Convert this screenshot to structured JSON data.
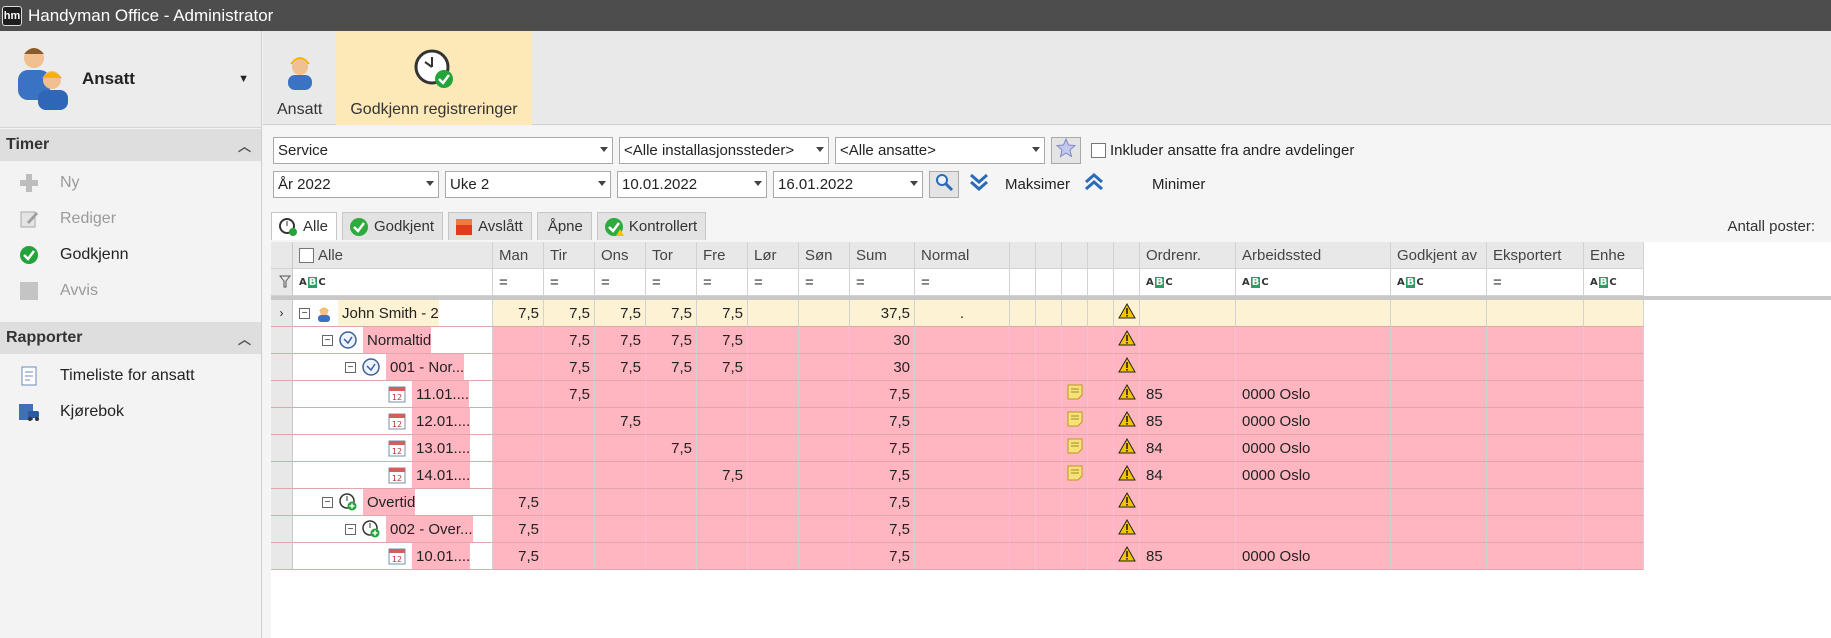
{
  "window": {
    "app_icon": "hm",
    "title": "Handyman Office - Administrator"
  },
  "sidebar": {
    "module_label": "Ansatt",
    "groups": [
      {
        "title": "Timer",
        "items": [
          {
            "label": "Ny",
            "icon": "plus-icon",
            "enabled": false
          },
          {
            "label": "Rediger",
            "icon": "edit-icon",
            "enabled": false
          },
          {
            "label": "Godkjenn",
            "icon": "check-icon",
            "enabled": true
          },
          {
            "label": "Avvis",
            "icon": "reject-icon",
            "enabled": false
          }
        ]
      },
      {
        "title": "Rapporter",
        "items": [
          {
            "label": "Timeliste for ansatt",
            "icon": "report-icon",
            "enabled": true
          },
          {
            "label": "Kjørebok",
            "icon": "car-icon",
            "enabled": true
          }
        ]
      }
    ]
  },
  "ribbon": {
    "buttons": [
      {
        "label": "Ansatt",
        "icon": "worker-icon",
        "active": false
      },
      {
        "label": "Godkjenn registreringer",
        "icon": "clock-check-icon",
        "active": true
      }
    ]
  },
  "filters": {
    "department": "Service",
    "location": "<Alle installasjonssteder>",
    "employees": "<Alle ansatte>",
    "include_other_departments_label": "Inkluder ansatte fra andre avdelinger",
    "include_other_departments": false,
    "year": "År 2022",
    "week": "Uke 2",
    "date_from": "10.01.2022",
    "date_to": "16.01.2022",
    "maximize_label": "Maksimer",
    "minimize_label": "Minimer"
  },
  "tabs": [
    {
      "label": "Alle",
      "active": true,
      "color": "#ffffff"
    },
    {
      "label": "Godkjent",
      "active": false,
      "color": "#2eaa3f"
    },
    {
      "label": "Avslått",
      "active": false,
      "color": "#e23b1c"
    },
    {
      "label": "Åpne",
      "active": false,
      "color": ""
    },
    {
      "label": "Kontrollert",
      "active": false,
      "color": "#2eaa3f"
    }
  ],
  "record_count_label": "Antall poster:",
  "grid": {
    "columns": [
      "Alle",
      "Man",
      "Tir",
      "Ons",
      "Tor",
      "Fre",
      "Lør",
      "Søn",
      "Sum",
      "Normal",
      "",
      "",
      "",
      "",
      "",
      "Ordrenr.",
      "Arbeidssted",
      "Godkjent av",
      "Eksportert",
      "Enhe"
    ],
    "filter_abc": "A B C",
    "filter_eq": "=",
    "rows": [
      {
        "level": 0,
        "label": "John Smith - 2",
        "icon": "person-icon",
        "color": "yellow",
        "days": [
          "7,5",
          "7,5",
          "7,5",
          "7,5",
          "7,5",
          "",
          ""
        ],
        "sum": "37,5",
        "normal": ".",
        "note": false,
        "warn": true,
        "ordre": "",
        "arbeidssted": ""
      },
      {
        "level": 1,
        "label": "Normaltid",
        "icon": "clock-icon",
        "color": "pink",
        "days": [
          "",
          "7,5",
          "7,5",
          "7,5",
          "7,5",
          "",
          ""
        ],
        "sum": "30",
        "normal": "",
        "note": false,
        "warn": true,
        "ordre": "",
        "arbeidssted": ""
      },
      {
        "level": 2,
        "label": "001 - Nor...",
        "icon": "clock-icon",
        "color": "pink",
        "days": [
          "",
          "7,5",
          "7,5",
          "7,5",
          "7,5",
          "",
          ""
        ],
        "sum": "30",
        "normal": "",
        "note": false,
        "warn": true,
        "ordre": "",
        "arbeidssted": ""
      },
      {
        "level": 3,
        "label": "11.01....",
        "icon": "calendar-icon",
        "color": "pink",
        "days": [
          "",
          "7,5",
          "",
          "",
          "",
          "",
          ""
        ],
        "sum": "7,5",
        "normal": "",
        "note": true,
        "warn": true,
        "ordre": "85",
        "arbeidssted": "0000 Oslo"
      },
      {
        "level": 3,
        "label": "12.01....",
        "icon": "calendar-icon",
        "color": "pink",
        "days": [
          "",
          "",
          "7,5",
          "",
          "",
          "",
          ""
        ],
        "sum": "7,5",
        "normal": "",
        "note": true,
        "warn": true,
        "ordre": "85",
        "arbeidssted": "0000 Oslo"
      },
      {
        "level": 3,
        "label": "13.01....",
        "icon": "calendar-icon",
        "color": "pink",
        "days": [
          "",
          "",
          "",
          "7,5",
          "",
          "",
          ""
        ],
        "sum": "7,5",
        "normal": "",
        "note": true,
        "warn": true,
        "ordre": "84",
        "arbeidssted": "0000 Oslo"
      },
      {
        "level": 3,
        "label": "14.01....",
        "icon": "calendar-icon",
        "color": "pink",
        "days": [
          "",
          "",
          "",
          "",
          "7,5",
          "",
          ""
        ],
        "sum": "7,5",
        "normal": "",
        "note": true,
        "warn": true,
        "ordre": "84",
        "arbeidssted": "0000 Oslo"
      },
      {
        "level": 1,
        "label": "Overtid",
        "icon": "overtime-icon",
        "color": "pink",
        "days": [
          "7,5",
          "",
          "",
          "",
          "",
          "",
          ""
        ],
        "sum": "7,5",
        "normal": "",
        "note": false,
        "warn": true,
        "ordre": "",
        "arbeidssted": ""
      },
      {
        "level": 2,
        "label": "002 - Over...",
        "icon": "overtime-icon",
        "color": "pink",
        "days": [
          "7,5",
          "",
          "",
          "",
          "",
          "",
          ""
        ],
        "sum": "7,5",
        "normal": "",
        "note": false,
        "warn": true,
        "ordre": "",
        "arbeidssted": ""
      },
      {
        "level": 3,
        "label": "10.01....",
        "icon": "calendar-icon",
        "color": "pink",
        "days": [
          "7,5",
          "",
          "",
          "",
          "",
          "",
          ""
        ],
        "sum": "7,5",
        "normal": "",
        "note": false,
        "warn": true,
        "ordre": "85",
        "arbeidssted": "0000 Oslo"
      }
    ]
  }
}
